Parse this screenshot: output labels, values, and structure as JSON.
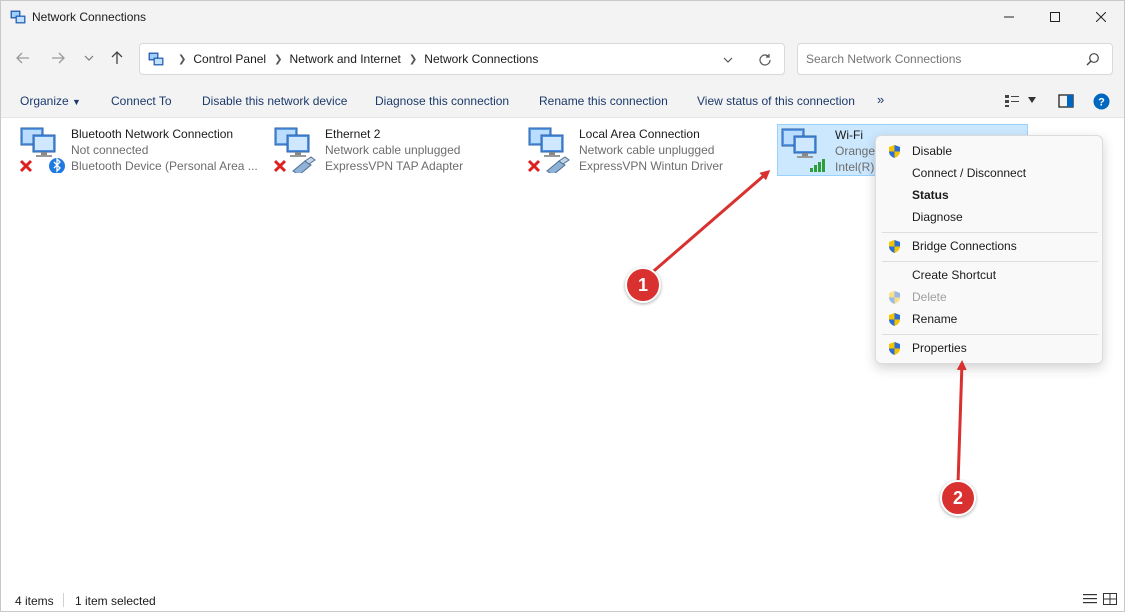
{
  "window": {
    "title": "Network Connections",
    "minimize_glyph": "—",
    "maximize_glyph": "☐",
    "close_glyph": "✕"
  },
  "nav": {
    "breadcrumbs": [
      "Control Panel",
      "Network and Internet",
      "Network Connections"
    ],
    "search_placeholder": "Search Network Connections"
  },
  "commands": {
    "organize": "Organize",
    "connect_to": "Connect To",
    "disable": "Disable this network device",
    "diagnose": "Diagnose this connection",
    "rename": "Rename this connection",
    "view_status": "View status of this connection",
    "more": "»"
  },
  "connections": [
    {
      "name": "Bluetooth Network Connection",
      "status": "Not connected",
      "device": "Bluetooth Device (Personal Area ...",
      "icon": "bluetooth-network-icon",
      "selected": false
    },
    {
      "name": "Ethernet 2",
      "status": "Network cable unplugged",
      "device": "ExpressVPN TAP Adapter",
      "icon": "ethernet-network-icon",
      "selected": false
    },
    {
      "name": "Local Area Connection",
      "status": "Network cable unplugged",
      "device": "ExpressVPN Wintun Driver",
      "icon": "ethernet-network-icon",
      "selected": false
    },
    {
      "name": "Wi-Fi",
      "status": "Orange",
      "device": "Intel(R)",
      "icon": "wifi-network-icon",
      "selected": true
    }
  ],
  "context_menu": {
    "disable": "Disable",
    "connect_disconnect": "Connect / Disconnect",
    "status": "Status",
    "diagnose": "Diagnose",
    "bridge": "Bridge Connections",
    "create_shortcut": "Create Shortcut",
    "delete": "Delete",
    "rename": "Rename",
    "properties": "Properties"
  },
  "statusbar": {
    "items_count": "4 items",
    "selected_count": "1 item selected"
  },
  "annotations": {
    "step1": "1",
    "step2": "2",
    "arrow_color": "#d9312f"
  },
  "colors": {
    "selection_bg": "#cce8ff",
    "selection_border": "#99d1ff",
    "command_text": "#1b3a6b",
    "help_blue": "#0067c0"
  }
}
